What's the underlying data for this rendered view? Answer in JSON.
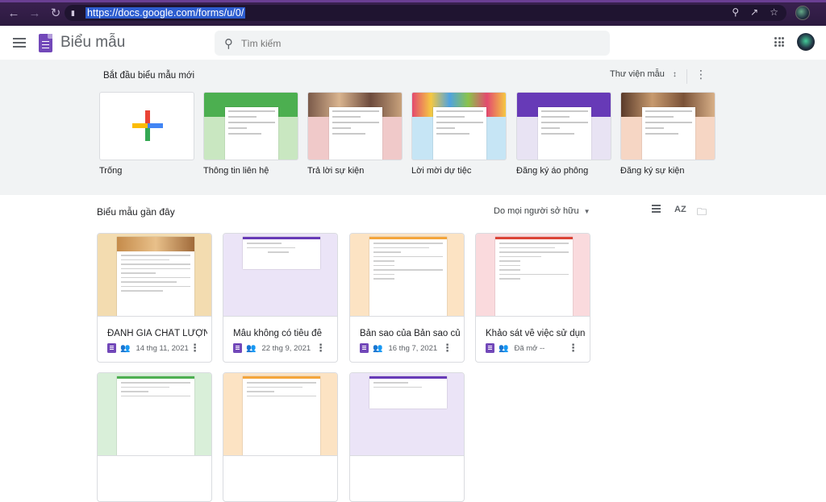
{
  "browser": {
    "url": "https://docs.google.com/forms/u/0/"
  },
  "header": {
    "app_title": "Biểu mẫu",
    "search_placeholder": "Tìm kiếm"
  },
  "gallery": {
    "title": "Bắt đầu biểu mẫu mới",
    "library_label": "Thư viện mẫu",
    "templates": [
      {
        "label": "Trống",
        "color": "#ffffff"
      },
      {
        "label": "Thông tin liên hệ",
        "color": "#c9e7c1",
        "band": "#4caf50"
      },
      {
        "label": "Trả lời sự kiện",
        "color": "#f0c9c9",
        "band": "#7b5a4a"
      },
      {
        "label": "Lời mời dự tiệc",
        "color": "#c6e5f5",
        "band": "#d48ab0"
      },
      {
        "label": "Đăng ký áo phông",
        "color": "#e8e3f3",
        "band": "#673ab7"
      },
      {
        "label": "Đăng ký sự kiện",
        "color": "#f6d6c4",
        "band": "#a36b4a"
      }
    ]
  },
  "recent": {
    "title": "Biểu mẫu gần đây",
    "owner_filter": "Do mọi người sở hữu",
    "sort_icon_label": "AZ",
    "cards": [
      {
        "title": "ĐÁNH GIÁ CHẤT LƯỢNG ...",
        "date": "14 thg 11, 2021",
        "bg": "#f3dcb0",
        "accent": "#c58b4a"
      },
      {
        "title": "Mẫu không có tiêu đề",
        "date": "22 thg 9, 2021",
        "bg": "#ebe4f7",
        "accent": "#673ab7"
      },
      {
        "title": "Bản sao của Bản sao của ...",
        "date": "16 thg 7, 2021",
        "bg": "#fce3c3",
        "accent": "#f4a53b"
      },
      {
        "title": "Khảo sát về việc sử dụng ...",
        "date": "Đã mở --",
        "bg": "#fadadd",
        "accent": "#db4437"
      },
      {
        "title": "",
        "date": "",
        "bg": "#d9efd9",
        "accent": "#4caf50"
      },
      {
        "title": "",
        "date": "",
        "bg": "#fce3c3",
        "accent": "#f4a53b"
      },
      {
        "title": "",
        "date": "",
        "bg": "#ebe4f7",
        "accent": "#673ab7"
      }
    ]
  }
}
